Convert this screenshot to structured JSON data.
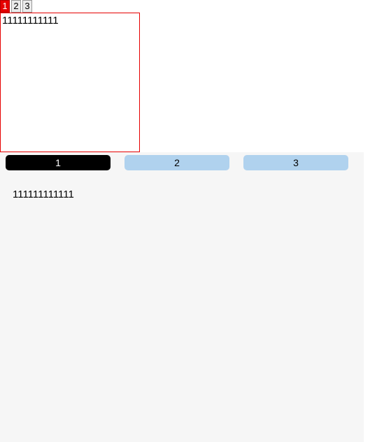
{
  "tabsetA": {
    "tabs": [
      {
        "label": "1",
        "active": true
      },
      {
        "label": "2",
        "active": false
      },
      {
        "label": "3",
        "active": false
      }
    ],
    "panel": "11111111111"
  },
  "tabsetB": {
    "tabs": [
      {
        "label": "1",
        "active": true
      },
      {
        "label": "2",
        "active": false
      },
      {
        "label": "3",
        "active": false
      }
    ],
    "panel": "111111111111"
  }
}
